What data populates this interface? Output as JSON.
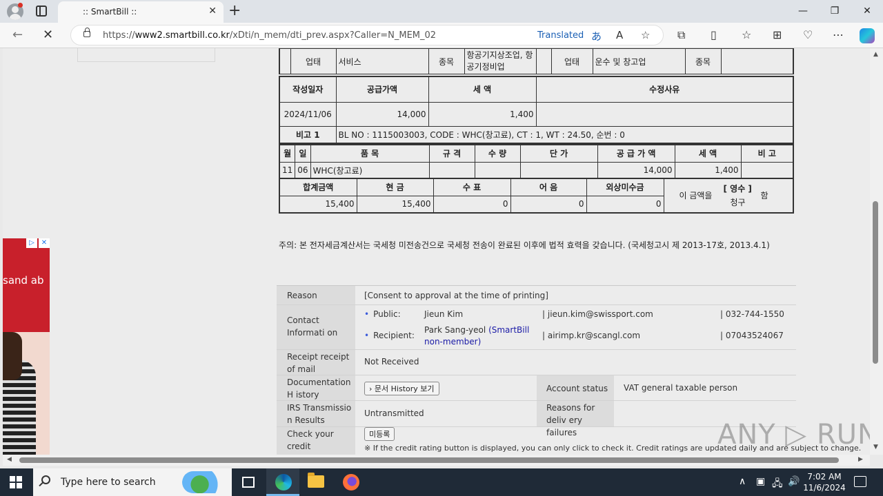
{
  "browser": {
    "tab_title": ":: SmartBill ::",
    "url_prefix": "https://",
    "url_host": "www2.smartbill.co.kr",
    "url_path": "/xDti/n_mem/dti_prev.aspx?Caller=N_MEM_02",
    "translated_label": "Translated",
    "minimize": "—",
    "restore": "❐",
    "close": "✕"
  },
  "ad": {
    "text": "sand ab",
    "badge1": "▷",
    "badge2": "✕"
  },
  "supplier_row": {
    "biz_type_label": "업태",
    "biz_type_value": "서비스",
    "item_label": "종목",
    "item_value": "항공기지상조업, 항공기정비업",
    "recv_biz_type_label": "업태",
    "recv_biz_type_value": "운수 및 창고업",
    "recv_item_label": "종목",
    "recv_item_value": ""
  },
  "summary": {
    "headers": [
      "작성일자",
      "공급가액",
      "세 액",
      "수정사유"
    ],
    "values": [
      "2024/11/06",
      "14,000",
      "1,400",
      ""
    ],
    "remark_label": "비고 1",
    "remark_value": "BL NO : 1115003003, CODE : WHC(창고료), CT : 1, WT : 24.50, 순번 : 0"
  },
  "items": {
    "headers": [
      "월",
      "일",
      "품 목",
      "규 격",
      "수 량",
      "단 가",
      "공 급 가 액",
      "세 액",
      "비 고"
    ],
    "rows": [
      [
        "11",
        "06",
        "WHC(창고료)",
        "",
        "",
        "",
        "14,000",
        "1,400",
        ""
      ]
    ]
  },
  "totals": {
    "headers": [
      "합계금액",
      "현 금",
      "수 표",
      "어 음",
      "외상미수금"
    ],
    "values": [
      "15,400",
      "15,400",
      "0",
      "0",
      "0"
    ],
    "amount_prefix": "이 금액을",
    "receipt": "[ 영수 ]",
    "claim": "청구",
    "suffix": "함"
  },
  "notice": "주의: 본 전자세금계산서는 국세청 미전송건으로 국세청 전송이 완료된 이후에 법적 효력을 갖습니다. (국세청고시 제 2013-17호, 2013.4.1)",
  "info": {
    "reason_label": "Reason",
    "reason_value": "[Consent to approval at the time of printing]",
    "contact_label": "Contact Informati on",
    "public_label": "Public:",
    "public_name": "Jieun Kim",
    "public_email": "| jieun.kim@swissport.com",
    "public_phone": "| 032-744-1550",
    "recipient_label": "Recipient:",
    "recipient_name": "Park Sang-yeol",
    "recipient_note": "(SmartBill non-member)",
    "recipient_email": "| airimp.kr@scangl.com",
    "recipient_phone": "| 07043524067",
    "receipt_label": "Receipt receipt of mail",
    "receipt_value": "Not Received",
    "doc_label": "Documentation H istory",
    "doc_button": "› 문서 History 보기",
    "account_label": "Account status",
    "account_value": "VAT general taxable person",
    "irs_label": "IRS Transmissio n Results",
    "irs_value": "Untransmitted",
    "failure_label": "Reasons for deliv ery failures",
    "failure_value": "",
    "credit_label": "Check your credit worthiness",
    "credit_button": "미등록",
    "credit_note": "※ If the credit rating button is displayed, you can only click to check it. Credit ratings are updated daily and are subject to change."
  },
  "watermark": "ANY ▷ RUN",
  "taskbar": {
    "search_placeholder": "Type here to search",
    "time": "7:02 AM",
    "date": "11/6/2024"
  }
}
